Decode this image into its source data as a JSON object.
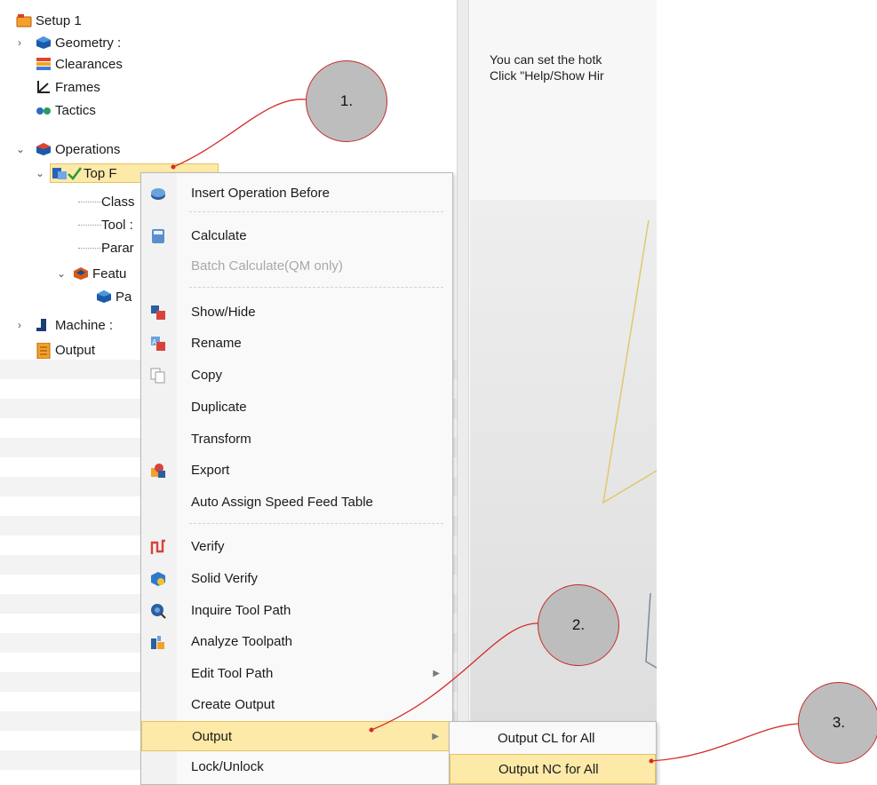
{
  "tree": {
    "items": [
      {
        "label": "Setup 1",
        "icon": "setup-icon"
      },
      {
        "label": "Geometry :",
        "icon": "geometry-icon"
      },
      {
        "label": "Clearances",
        "icon": "clearances-icon"
      },
      {
        "label": "Frames",
        "icon": "frames-icon"
      },
      {
        "label": "Tactics",
        "icon": "tactics-icon"
      },
      {
        "label": "Operations",
        "icon": "operations-icon"
      },
      {
        "label": "Top F",
        "icon": "operation-done-icon"
      },
      {
        "label": "Class"
      },
      {
        "label": "Tool :"
      },
      {
        "label": "Parar"
      },
      {
        "label": "Featu",
        "icon": "feature-icon"
      },
      {
        "label": "Pa",
        "icon": "part-icon"
      },
      {
        "label": "Machine :",
        "icon": "machine-icon"
      },
      {
        "label": "Output",
        "icon": "output-icon"
      }
    ]
  },
  "hint": {
    "line1": "You can set the hotk",
    "line2": "Click \"Help/Show Hir"
  },
  "context_menu": {
    "items": [
      {
        "label": "Insert Operation Before",
        "icon": "insert-operation-icon"
      },
      {
        "label": "Calculate",
        "icon": "calculate-icon"
      },
      {
        "label": "Batch Calculate(QM only)",
        "disabled": true
      },
      {
        "label": "Show/Hide",
        "icon": "show-hide-icon"
      },
      {
        "label": "Rename",
        "icon": "rename-icon"
      },
      {
        "label": "Copy",
        "icon": "copy-icon"
      },
      {
        "label": "Duplicate"
      },
      {
        "label": "Transform"
      },
      {
        "label": "Export",
        "icon": "export-icon"
      },
      {
        "label": "Auto Assign Speed Feed Table"
      },
      {
        "label": "Verify",
        "icon": "verify-icon"
      },
      {
        "label": "Solid Verify",
        "icon": "solid-verify-icon"
      },
      {
        "label": "Inquire Tool Path",
        "icon": "inquire-icon"
      },
      {
        "label": "Analyze Toolpath",
        "icon": "analyze-icon"
      },
      {
        "label": "Edit Tool Path",
        "has_submenu": true
      },
      {
        "label": "Create Output"
      },
      {
        "label": "Output",
        "has_submenu": true,
        "highlighted": true
      },
      {
        "label": "Lock/Unlock"
      }
    ]
  },
  "submenu": {
    "items": [
      {
        "label": "Output CL for All"
      },
      {
        "label": "Output NC for All",
        "highlighted": true
      }
    ]
  },
  "callouts": [
    "1.",
    "2.",
    "3."
  ],
  "colors": {
    "highlight": "#fde9a8",
    "highlight_border": "#e5c45f",
    "callout_fill": "#bdbdbd",
    "callout_line": "#d42a2a",
    "check": "#2e9a3c"
  }
}
